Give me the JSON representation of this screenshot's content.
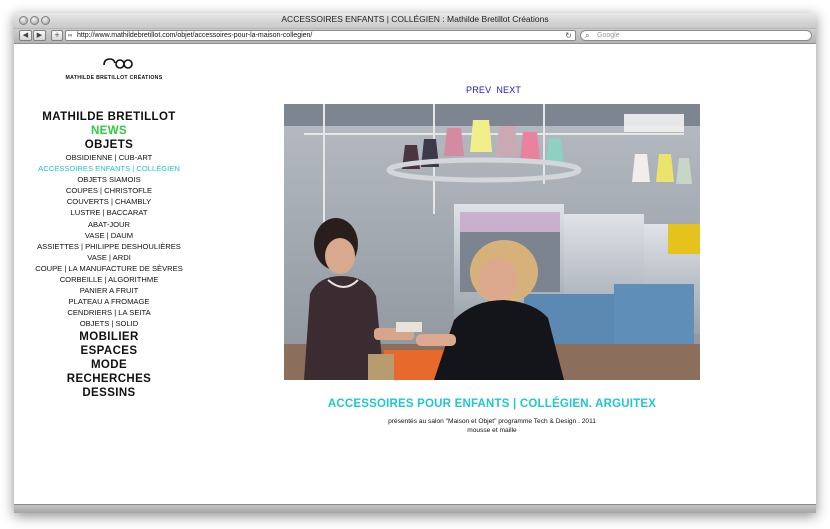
{
  "window": {
    "title": "ACCESSOIRES ENFANTS | COLLÉGIEN : Mathilde Bretillot Créations",
    "url": "http://www.mathildebretillot.com/objet/accessoires-pour-la-maison-collegien/",
    "search_placeholder": "Google"
  },
  "toolbar": {
    "back_icon": "back-arrow-icon",
    "forward_icon": "forward-arrow-icon",
    "add_icon": "plus-icon",
    "reload_icon": "reload-icon"
  },
  "logo": {
    "text": "MATHILDE BRETILLOT CRÉATIONS"
  },
  "nav": {
    "home": "MATHILDE BRETILLOT",
    "news": "NEWS",
    "objets": "OBJETS",
    "objets_items": [
      "OBSIDIENNE | CUB-ART",
      "ACCESSOIRES ENFANTS | COLLÉGIEN",
      "OBJETS SIAMOIS",
      "COUPES | CHRISTOFLE",
      "COUVERTS | CHAMBLY",
      "LUSTRE | BACCARAT",
      "ABAT-JOUR",
      "VASE | DAUM",
      "ASSIETTES | PHILIPPE DESHOULIÈRES",
      "VASE | ARDI",
      "COUPE | LA MANUFACTURE DE SÈVRES",
      "CORBEILLE | ALGORITHME",
      "PANIER A FRUIT",
      "PLATEAU A FROMAGE",
      "CENDRIERS | LA SEITA",
      "OBJETS | SOLID"
    ],
    "active_index": 1,
    "sections": [
      "MOBILIER",
      "ESPACES",
      "MODE",
      "RECHERCHES",
      "DESSINS"
    ]
  },
  "pager": {
    "prev": "PREV",
    "next": "NEXT"
  },
  "caption": {
    "title": "ACCESSOIRES POUR ENFANTS | COLLÉGIEN. ARGUITEX",
    "line1": "présentés au salon \"Maison et Objet\" programme Tech & Design . 2011",
    "line2": "mousse et maille"
  },
  "colors": {
    "accent_green": "#2ecc40",
    "accent_cyan": "#1ec9c9",
    "link_blue": "#1c1ccc"
  }
}
